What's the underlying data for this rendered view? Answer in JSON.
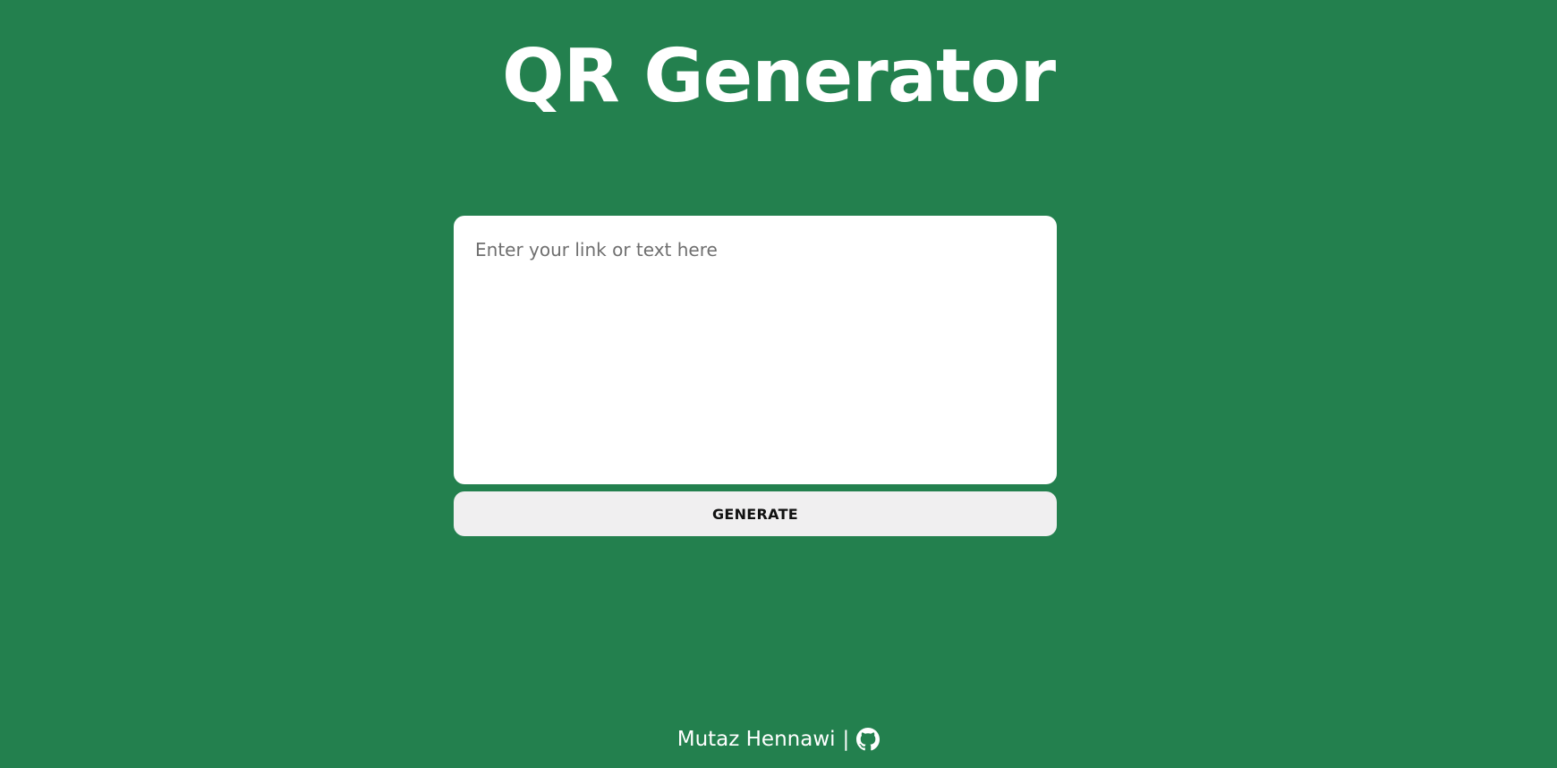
{
  "page": {
    "title": "QR Generator",
    "background_color": "#23804e"
  },
  "form": {
    "input_placeholder": "Enter your link or text here",
    "input_value": "",
    "generate_label": "GENERATE"
  },
  "footer": {
    "author": "Mutaz Hennawi",
    "separator": "|",
    "link_icon": "github-icon"
  }
}
